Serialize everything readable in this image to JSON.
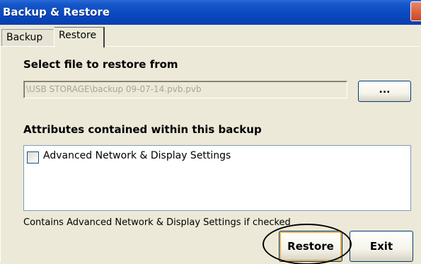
{
  "window": {
    "title": "Backup & Restore",
    "close_icon": "close-icon"
  },
  "tabs": [
    {
      "label": "Backup",
      "active": false
    },
    {
      "label": "Restore",
      "active": true
    }
  ],
  "restore": {
    "select_heading": "Select file to restore from",
    "file_path": "\\USB STORAGE\\backup 09-07-14.pvb.pvb",
    "browse_label": "...",
    "attributes_heading": "Attributes contained within this backup",
    "attributes": [
      {
        "label": "Advanced Network & Display Settings",
        "checked": false
      }
    ],
    "note": "Contains Advanced Network & Display Settings if checked"
  },
  "buttons": {
    "restore_label": "Restore",
    "exit_label": "Exit"
  },
  "colors": {
    "titlebar": "#0a48bf",
    "window_bg": "#ece9d8",
    "close_button": "#d0451f"
  }
}
